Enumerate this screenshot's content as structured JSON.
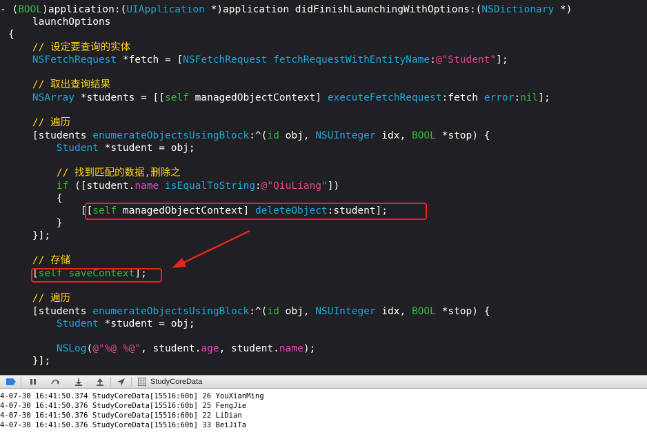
{
  "colors": {
    "keyword": "#35b93a",
    "type": "#1fa7d6",
    "string": "#e0478c",
    "comment": "#ffd21c",
    "property": "#d84fc0",
    "highlight": "#e8241e",
    "editor_bg": "#1f1f24"
  },
  "code": [
    {
      "tokens": [
        [
          "-",
          "p"
        ],
        [
          " ("
        ],
        [
          "BOOL",
          "kw"
        ],
        [
          ")application:("
        ],
        [
          "UIApplication",
          "ty"
        ],
        [
          " *)application didFinishLaunchingWithOptions:("
        ],
        [
          "NSDictionary",
          "ty"
        ],
        [
          " *)"
        ]
      ]
    },
    {
      "tokens": [
        [
          "    launchOptions"
        ]
      ]
    },
    {
      "tokens": [
        [
          "{"
        ]
      ]
    },
    {
      "tokens": [
        [
          "    "
        ],
        [
          "// 设定要查询的实体",
          "cm"
        ]
      ]
    },
    {
      "tokens": [
        [
          "    "
        ],
        [
          "NSFetchRequest",
          "ty"
        ],
        [
          " *fetch = ["
        ],
        [
          "NSFetchRequest",
          "ty"
        ],
        [
          " "
        ],
        [
          "fetchRequestWithEntityName",
          "ty"
        ],
        [
          ":"
        ],
        [
          "@\"Student\"",
          "st"
        ],
        [
          "];"
        ]
      ]
    },
    {
      "tokens": [
        [
          ""
        ]
      ]
    },
    {
      "tokens": [
        [
          "    "
        ],
        [
          "// 取出查询结果",
          "cm"
        ]
      ]
    },
    {
      "tokens": [
        [
          "    "
        ],
        [
          "NSArray",
          "ty"
        ],
        [
          " *students = [["
        ],
        [
          "self",
          "kw"
        ],
        [
          " managedObjectContext] "
        ],
        [
          "executeFetchRequest",
          "ty"
        ],
        [
          ":fetch "
        ],
        [
          "error",
          "ty"
        ],
        [
          ":"
        ],
        [
          "nil",
          "kw"
        ],
        [
          "];"
        ]
      ]
    },
    {
      "tokens": [
        [
          ""
        ]
      ]
    },
    {
      "tokens": [
        [
          "    "
        ],
        [
          "// 遍历",
          "cm"
        ]
      ]
    },
    {
      "tokens": [
        [
          "    [students "
        ],
        [
          "enumerateObjectsUsingBlock",
          "ty"
        ],
        [
          ":^("
        ],
        [
          "id",
          "kw"
        ],
        [
          " obj, "
        ],
        [
          "NSUInteger",
          "ty"
        ],
        [
          " idx, "
        ],
        [
          "BOOL",
          "kw"
        ],
        [
          " *stop) {"
        ]
      ]
    },
    {
      "tokens": [
        [
          "        "
        ],
        [
          "Student",
          "ty"
        ],
        [
          " *student = obj;"
        ]
      ]
    },
    {
      "tokens": [
        [
          ""
        ]
      ]
    },
    {
      "tokens": [
        [
          "        "
        ],
        [
          "// 找到匹配的数据,删除之",
          "cm"
        ]
      ]
    },
    {
      "tokens": [
        [
          "        "
        ],
        [
          "if",
          "kw"
        ],
        [
          " ([student."
        ],
        [
          "name",
          "pr"
        ],
        [
          " "
        ],
        [
          "isEqualToString",
          "ty"
        ],
        [
          ":"
        ],
        [
          "@\"QiuLiang\"",
          "st"
        ],
        [
          "])"
        ]
      ]
    },
    {
      "tokens": [
        [
          "        {"
        ]
      ]
    },
    {
      "tokens": [
        [
          "            [["
        ],
        [
          "self",
          "kw"
        ],
        [
          " managedObjectContext] "
        ],
        [
          "deleteObject",
          "ty"
        ],
        [
          ":student];"
        ]
      ]
    },
    {
      "tokens": [
        [
          "        }"
        ]
      ]
    },
    {
      "tokens": [
        [
          "    }];"
        ]
      ]
    },
    {
      "tokens": [
        [
          ""
        ]
      ]
    },
    {
      "tokens": [
        [
          "    "
        ],
        [
          "// 存储",
          "cm"
        ]
      ]
    },
    {
      "tokens": [
        [
          "    ["
        ],
        [
          "self",
          "kw"
        ],
        [
          " "
        ],
        [
          "saveContext",
          "kw"
        ],
        [
          "];"
        ]
      ]
    },
    {
      "tokens": [
        [
          ""
        ]
      ]
    },
    {
      "tokens": [
        [
          "    "
        ],
        [
          "// 遍历",
          "cm"
        ]
      ]
    },
    {
      "tokens": [
        [
          "    [students "
        ],
        [
          "enumerateObjectsUsingBlock",
          "ty"
        ],
        [
          ":^("
        ],
        [
          "id",
          "kw"
        ],
        [
          " obj, "
        ],
        [
          "NSUInteger",
          "ty"
        ],
        [
          " idx, "
        ],
        [
          "BOOL",
          "kw"
        ],
        [
          " *stop) {"
        ]
      ]
    },
    {
      "tokens": [
        [
          "        "
        ],
        [
          "Student",
          "ty"
        ],
        [
          " *student = obj;"
        ]
      ]
    },
    {
      "tokens": [
        [
          ""
        ]
      ]
    },
    {
      "tokens": [
        [
          "        "
        ],
        [
          "NSLog",
          "ty"
        ],
        [
          "("
        ],
        [
          "@\"%@ %@\"",
          "st"
        ],
        [
          ", student."
        ],
        [
          "age",
          "pr"
        ],
        [
          ", student."
        ],
        [
          "name",
          "pr"
        ],
        [
          ");"
        ]
      ]
    },
    {
      "tokens": [
        [
          "    }];"
        ]
      ]
    }
  ],
  "toolbar": {
    "icons": [
      "breakpoint-toggle-icon",
      "pause-icon",
      "step-over-icon",
      "step-into-icon",
      "step-out-icon",
      "location-icon",
      "grid-icon"
    ],
    "target": "StudyCoreData"
  },
  "console": [
    "4-07-30 16:41:50.374 StudyCoreData[15516:60b] 26 YouXianMing",
    "4-07-30 16:41:50.376 StudyCoreData[15516:60b] 25 FengJie",
    "4-07-30 16:41:50.376 StudyCoreData[15516:60b] 22 LiDian",
    "4-07-30 16:41:50.376 StudyCoreData[15516:60b] 33 BeiJiTa"
  ]
}
